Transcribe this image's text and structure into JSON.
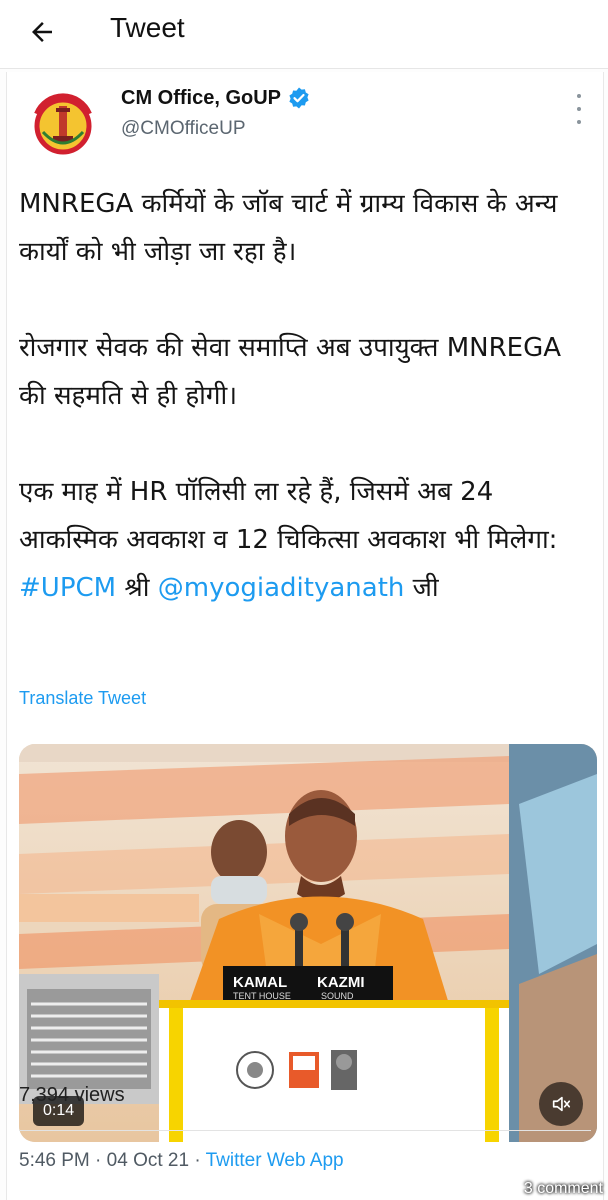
{
  "header": {
    "title": "Tweet"
  },
  "tweet": {
    "author_name": "CM Office, GoUP",
    "handle": "@CMOfficeUP",
    "verified": true,
    "paragraphs": {
      "p1": "MNREGA कर्मियों के जॉब चार्ट में ग्राम्य विकास के अन्य कार्यों को भी जोड़ा जा रहा है।",
      "p2": "रोजगार सेवक की सेवा समाप्ति अब उपायुक्त MNREGA की सहमति से ही होगी।",
      "p3_pre": "एक माह में HR पॉलिसी ला रहे हैं, जिसमें अब 24 आकस्मिक अवकाश व 12 चिकित्सा अवकाश भी मिलेगा: ",
      "p3_hashtag": "#UPCM",
      "p3_mid": " श्री ",
      "p3_mention": "@myogiadityanath",
      "p3_post": " जी"
    },
    "translate_label": "Translate Tweet",
    "video": {
      "duration": "0:14",
      "banner_left": "KAMAL",
      "banner_right": "KAZMI",
      "banner_sub_left": "TENT HOUSE",
      "banner_sub_right": "SOUND"
    },
    "views": "7,394 views",
    "time": "5:46 PM",
    "separator": " · ",
    "date": "04 Oct 21",
    "source_app": "Twitter Web App",
    "comments_overlay": "3 comment"
  },
  "colors": {
    "link": "#1d9bf0",
    "verified": "#1d9bf0",
    "avatar_ring": "#d1202f",
    "avatar_bg": "#f4c430"
  },
  "icons": {
    "back": "back-arrow-icon",
    "verified": "verified-badge-icon",
    "more": "more-vertical-icon",
    "mute": "volume-muted-icon"
  }
}
